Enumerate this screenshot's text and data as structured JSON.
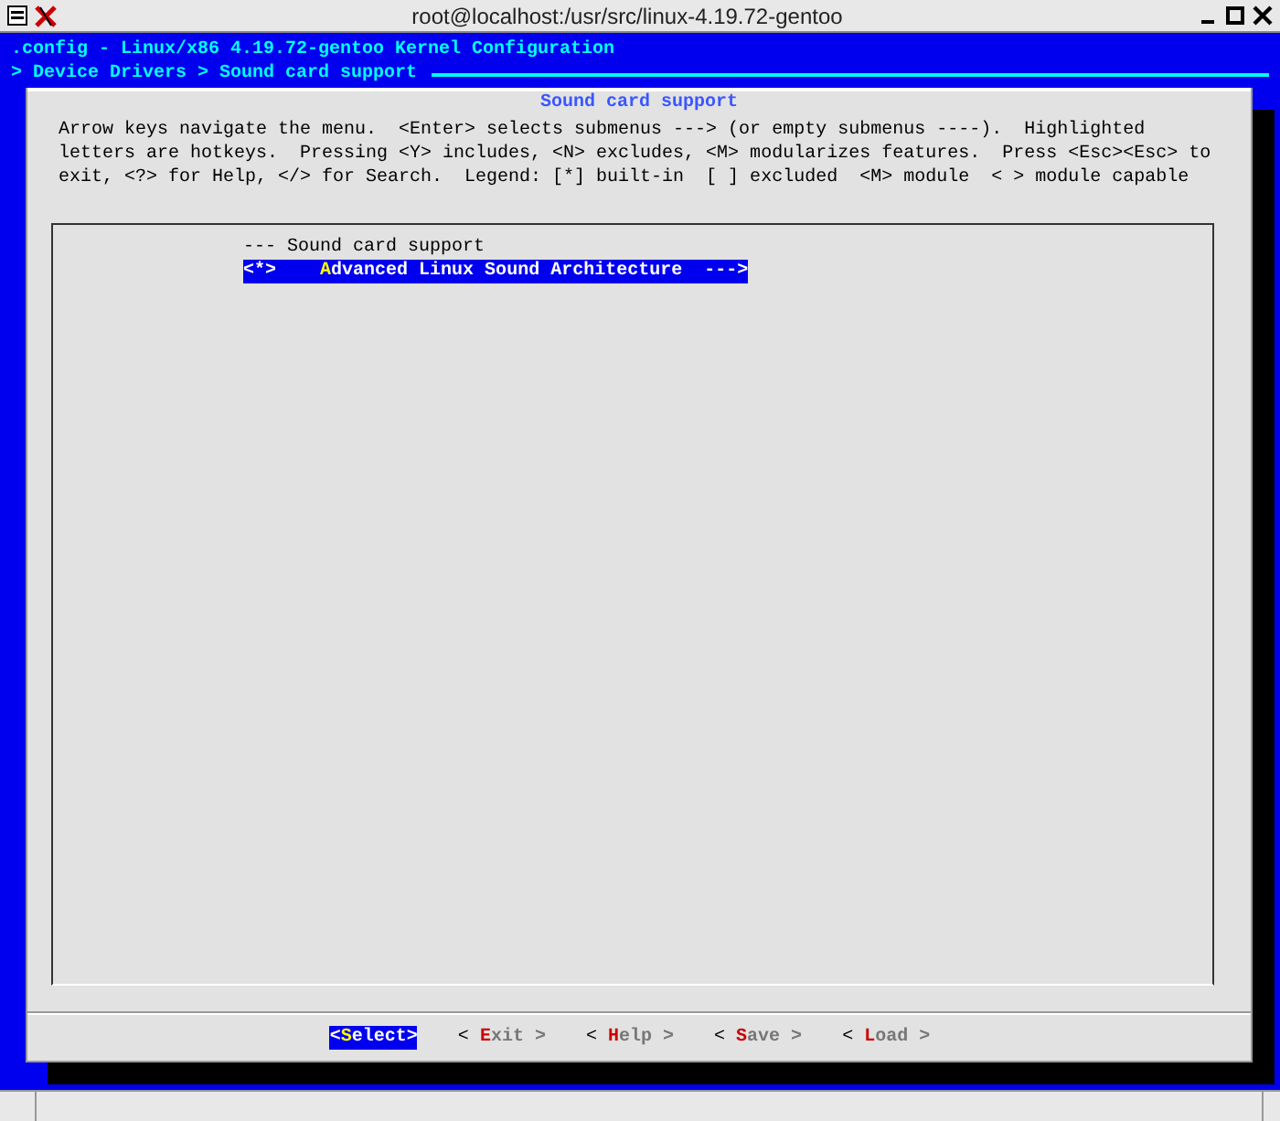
{
  "window": {
    "title": "root@localhost:/usr/src/linux-4.19.72-gentoo"
  },
  "header": ".config - Linux/x86 4.19.72-gentoo Kernel Configuration",
  "breadcrumb": "> Device Drivers > Sound card support",
  "dialog": {
    "title": "Sound card support",
    "help": [
      "Arrow keys navigate the menu.  <Enter> selects submenus ---> (or empty submenus ----).  Highlighted",
      "letters are hotkeys.  Pressing <Y> includes, <N> excludes, <M> modularizes features.  Press <Esc><Esc> to",
      "exit, <?> for Help, </> for Search.  Legend: [*] built-in  [ ] excluded  <M> module  < > module capable"
    ],
    "items": [
      {
        "kind": "comment",
        "text": "--- Sound card support",
        "selected": false
      },
      {
        "kind": "tristate",
        "state": "<*>",
        "hotkey": "A",
        "rest": "dvanced Linux Sound Architecture",
        "submenu": "--->",
        "selected": true
      }
    ],
    "buttons": [
      {
        "prefix": "<",
        "hotkey": "S",
        "rest": "elect>",
        "selected": true
      },
      {
        "prefix": "< ",
        "hotkey": "E",
        "rest": "xit >",
        "selected": false
      },
      {
        "prefix": "< ",
        "hotkey": "H",
        "rest": "elp >",
        "selected": false
      },
      {
        "prefix": "< ",
        "hotkey": "S",
        "rest": "ave >",
        "selected": false
      },
      {
        "prefix": "< ",
        "hotkey": "L",
        "rest": "oad >",
        "selected": false
      }
    ]
  }
}
